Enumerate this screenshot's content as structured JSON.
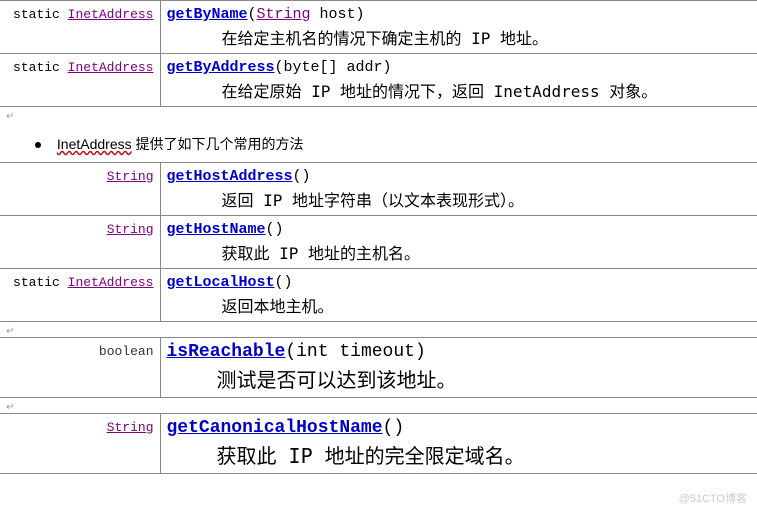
{
  "table1": {
    "rows": [
      {
        "modifier_static": "static",
        "modifier_type": "InetAddress",
        "method": "getByName",
        "params_open": "(",
        "param_type": "String",
        "param_name": " host)",
        "desc": "在给定主机名的情况下确定主机的 IP 地址。"
      },
      {
        "modifier_static": "static",
        "modifier_type": "InetAddress",
        "method": "getByAddress",
        "params_open": "(byte[] addr)",
        "param_type": "",
        "param_name": "",
        "desc": "在给定原始 IP 地址的情况下，返回 InetAddress 对象。"
      }
    ]
  },
  "bullet": {
    "class_name": "InetAddress",
    "text_after": " 提供了如下几个常用的方法"
  },
  "table2": {
    "rows": [
      {
        "modifier_static": "",
        "modifier_type": "String",
        "method": "getHostAddress",
        "params": "()",
        "desc": "返回 IP 地址字符串（以文本表现形式）。"
      },
      {
        "modifier_static": "",
        "modifier_type": "String",
        "method": "getHostName",
        "params": "()",
        "desc": "获取此 IP 地址的主机名。"
      },
      {
        "modifier_static": "static",
        "modifier_type": "InetAddress",
        "method": "getLocalHost",
        "params": "()",
        "desc": "返回本地主机。"
      }
    ]
  },
  "table3": {
    "rows": [
      {
        "modifier_static": "",
        "modifier_type": "boolean",
        "modifier_type_link": false,
        "method": "isReachable",
        "params": "(int timeout)",
        "desc": "测试是否可以达到该地址。"
      }
    ]
  },
  "table4": {
    "rows": [
      {
        "modifier_static": "",
        "modifier_type": "String",
        "method": "getCanonicalHostName",
        "params": "()",
        "desc": "获取此 IP 地址的完全限定域名。"
      }
    ]
  },
  "watermark": "@51CTO博客"
}
